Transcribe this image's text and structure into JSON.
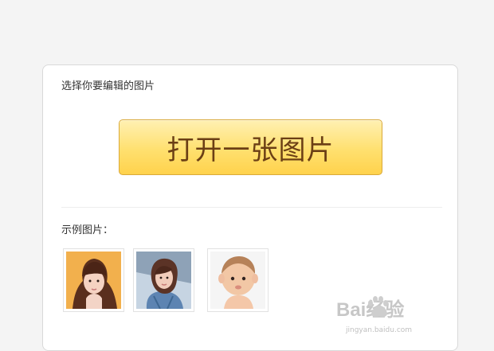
{
  "panel": {
    "title": "选择你要编辑的图片",
    "open_button_label": "打开一张图片",
    "examples_label": "示例图片："
  },
  "examples": [
    {
      "name": "example-photo-1",
      "subject": "woman with bangs"
    },
    {
      "name": "example-photo-2",
      "subject": "woman in denim jacket"
    },
    {
      "name": "example-photo-3",
      "subject": "baby"
    }
  ],
  "watermark": {
    "brand": "Bai经验",
    "url": "jingyan.baidu.com"
  },
  "colors": {
    "page_background": "#f4f4f4",
    "button_top": "#fff0b2",
    "button_bottom": "#ffd24c",
    "button_border": "#d9a93b",
    "button_text": "#6b3f15"
  }
}
